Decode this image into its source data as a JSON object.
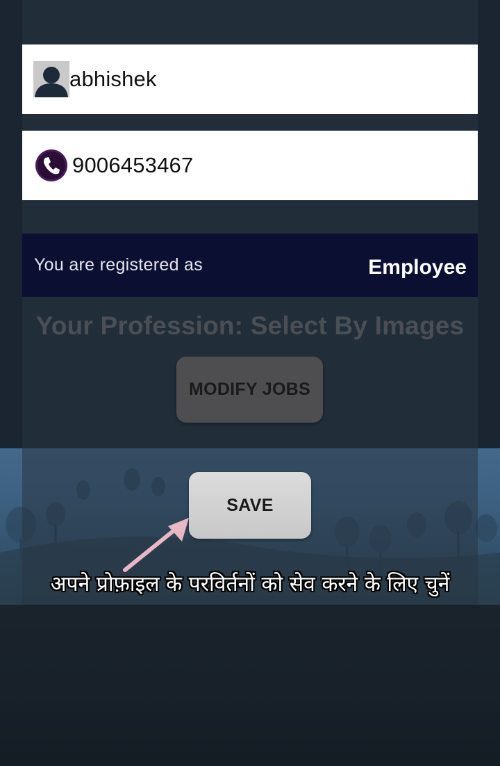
{
  "profile": {
    "name": "abhishek",
    "phone": "9006453467",
    "name_icon": "user-avatar-icon",
    "phone_icon": "phone-icon"
  },
  "registration": {
    "label": "You are registered as",
    "role": "Employee"
  },
  "profession": {
    "heading": "Your Profession: Select By Images"
  },
  "actions": {
    "modify_jobs_label": "MODIFY JOBS",
    "save_label": "SAVE"
  },
  "tutorial": {
    "hint_text": "अपने प्रोफ़ाइल के परविर्तनों को सेव करने के लिए चुनें",
    "arrow_icon": "arrow-pointer-icon"
  },
  "colors": {
    "band": "#0b0f32",
    "field_background": "#ffffff",
    "phone_icon_purple": "#4a1b5c",
    "arrow": "#e8b8c4"
  }
}
